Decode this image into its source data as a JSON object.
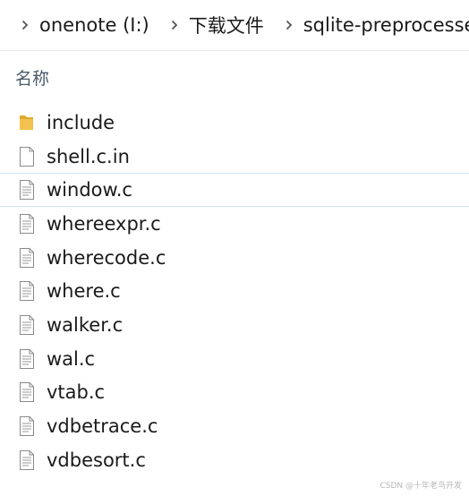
{
  "breadcrumb": {
    "items": [
      "onenote (I:)",
      "下载文件",
      "sqlite-preprocessed"
    ]
  },
  "columns": {
    "name_header": "名称"
  },
  "files": [
    {
      "name": "include",
      "icon": "folder-icon"
    },
    {
      "name": "shell.c.in",
      "icon": "blank-file-icon"
    },
    {
      "name": "window.c",
      "icon": "text-file-icon"
    },
    {
      "name": "whereexpr.c",
      "icon": "text-file-icon"
    },
    {
      "name": "wherecode.c",
      "icon": "text-file-icon"
    },
    {
      "name": "where.c",
      "icon": "text-file-icon"
    },
    {
      "name": "walker.c",
      "icon": "text-file-icon"
    },
    {
      "name": "wal.c",
      "icon": "text-file-icon"
    },
    {
      "name": "vtab.c",
      "icon": "text-file-icon"
    },
    {
      "name": "vdbetrace.c",
      "icon": "text-file-icon"
    },
    {
      "name": "vdbesort.c",
      "icon": "text-file-icon"
    }
  ],
  "watermark": "CSDN @十年老鸟开发",
  "colors": {
    "folder": "#f2c14e",
    "hover_border": "#cfe3f3",
    "header_text": "#4a5a6a"
  }
}
